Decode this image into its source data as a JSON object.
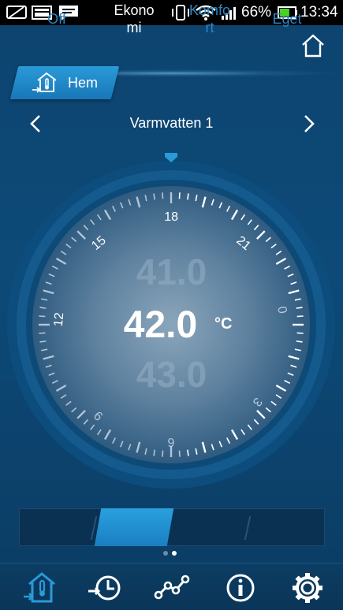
{
  "status_bar": {
    "battery_percent": "66%",
    "time": "13:34",
    "battery_level": 0.66
  },
  "header": {
    "home_icon": "home-icon"
  },
  "breadcrumb": {
    "label": "Hem",
    "icon": "house-thermometer-icon"
  },
  "title_nav": {
    "title": "Varmvatten 1",
    "prev_icon": "chevron-left-icon",
    "next_icon": "chevron-right-icon"
  },
  "dial": {
    "previous_value": "41.0",
    "current_value": "42.0",
    "next_value": "43.0",
    "unit": "°C",
    "hour_labels": [
      "12",
      "15",
      "18",
      "21",
      "0",
      "3",
      "6",
      "9"
    ]
  },
  "modes": {
    "items": [
      {
        "label_line1": "Off",
        "label_line2": ""
      },
      {
        "label_line1": "Ekono",
        "label_line2": "mi"
      },
      {
        "label_line1": "Komfo",
        "label_line2": "rt"
      },
      {
        "label_line1": "Eget",
        "label_line2": ""
      }
    ],
    "active_index": 1
  },
  "pager": {
    "pages": 2,
    "current": 2
  },
  "bottom_nav": {
    "items": [
      "home-icon",
      "schedule-clock-icon",
      "statistics-graph-icon",
      "info-icon",
      "settings-gear-icon"
    ],
    "active_index": 0
  },
  "colors": {
    "accent": "#2a9ad8",
    "inactive_text": "#2d86c6",
    "background": "#0d4470"
  }
}
